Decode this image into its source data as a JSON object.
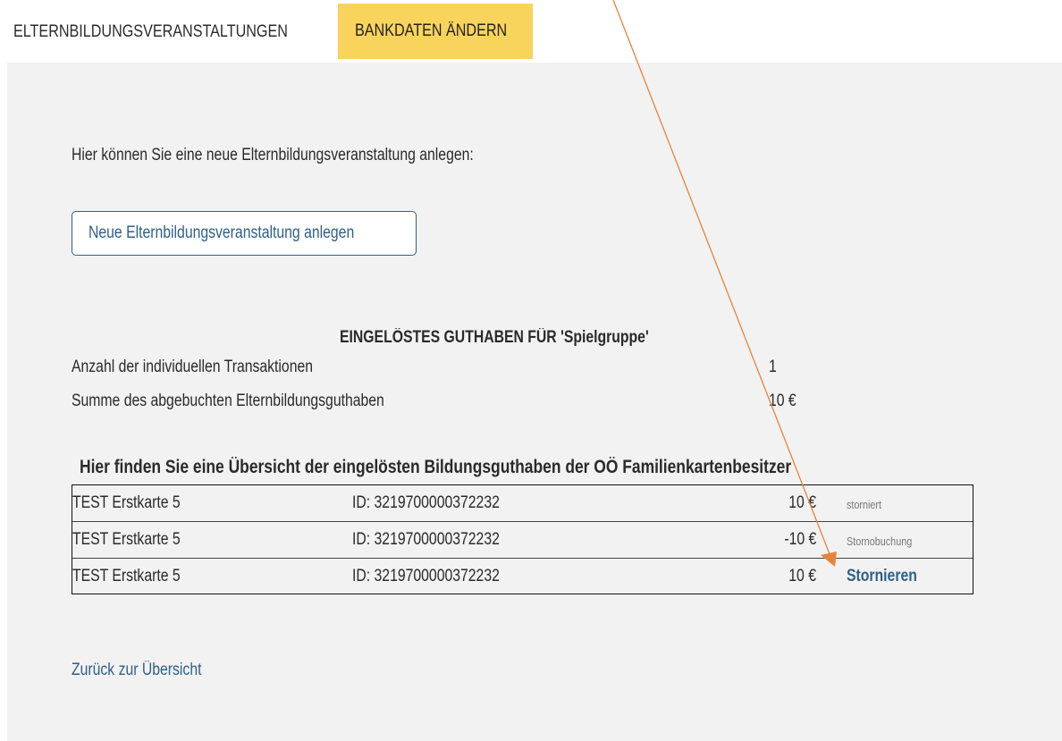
{
  "tabs": {
    "active_label": "ELTERNBILDUNGSVERANSTALTUNGEN",
    "bank_label": "BANKDATEN ÄNDERN"
  },
  "intro_text": "Hier können Sie eine neue Elternbildungsveranstaltung anlegen:",
  "new_button_label": "Neue Elternbildungsveranstaltung anlegen",
  "summary": {
    "title": "EINGELÖSTES GUTHABEN FÜR 'Spielgruppe'",
    "rows": [
      {
        "label": "Anzahl der individuellen Transaktionen",
        "value": "1"
      },
      {
        "label": "Summe des abgebuchten Elternbildungsguthaben",
        "value": "10 €"
      }
    ]
  },
  "overview": {
    "title": "Hier finden Sie eine Übersicht der eingelösten Bildungsguthaben der OÖ Familienkartenbesitzer",
    "rows": [
      {
        "name": "TEST Erstkarte 5",
        "id": "ID: 3219700000372232",
        "amount": "10 €",
        "status": "storniert"
      },
      {
        "name": "TEST Erstkarte 5",
        "id": "ID: 3219700000372232",
        "amount": "-10 €",
        "status": "Stornobuchung"
      },
      {
        "name": "TEST Erstkarte 5",
        "id": "ID: 3219700000372232",
        "amount": "10 €",
        "action": "Stornieren"
      }
    ]
  },
  "back_link": "Zurück zur Übersicht",
  "colors": {
    "tab_yellow": "#f9d45c",
    "panel_bg": "#f2f2f2",
    "link_blue": "#2e5f88",
    "annotation_arrow": "#e8833a"
  }
}
